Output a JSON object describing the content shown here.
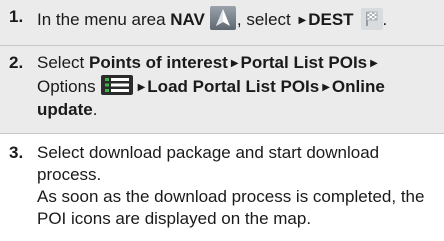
{
  "steps": [
    {
      "number": "1.",
      "parts": {
        "t1": "In the menu area ",
        "b1": "NAV",
        "t2": ", select ",
        "b2": "DEST",
        "t3": "."
      }
    },
    {
      "number": "2.",
      "parts": {
        "t1": "Select ",
        "b1": "Points of interest",
        "b2": "Portal List POIs",
        "t2": "Options",
        "b3": "Load Portal List POIs",
        "b4": "Online update",
        "t3": "."
      }
    },
    {
      "number": "3.",
      "line1": "Select download package and start download process.",
      "line2": "As soon as the download process is completed, the POI icons are displayed on the map."
    }
  ],
  "icons": {
    "nav": "navigation-arrow-icon",
    "dest": "destination-flag-icon",
    "options": "options-menu-icon",
    "arrow": "triangle-right-icon"
  },
  "colors": {
    "shaded_row": "#ebebeb",
    "text": "#1a1a1a",
    "icon_dark": "#2b2b2b",
    "icon_accent": "#3fb24a"
  }
}
